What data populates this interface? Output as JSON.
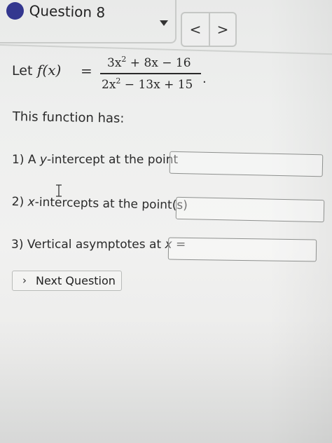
{
  "header": {
    "question_title": "Question 8",
    "prev_label": "<",
    "next_label": ">"
  },
  "problem": {
    "let_label": "Let",
    "function_lhs": "f(x)",
    "equals": "=",
    "numerator": {
      "a": "3x",
      "exp": "2",
      "rest": " + 8x − 16"
    },
    "denominator": {
      "a": "2x",
      "exp": "2",
      "rest": " − 13x + 15"
    },
    "period": "."
  },
  "intro_text": "This function has:",
  "items": [
    {
      "prefix": "1) A ",
      "var": "y",
      "suffix": "-intercept at the point"
    },
    {
      "prefix": "2) ",
      "var": "x",
      "suffix": "-intercepts at the point(s)"
    },
    {
      "prefix": "3) Vertical asymptotes at ",
      "var": "x",
      "suffix": " ="
    }
  ],
  "answers": [
    "",
    "",
    ""
  ],
  "next_question_label": "Next Question",
  "colors": {
    "question_dot": "#34378f",
    "background": "#eeefee",
    "border": "#8e908e"
  },
  "icons": {
    "status": "filled-circle",
    "dropdown": "caret-down-icon",
    "prev": "chevron-left-icon",
    "next": "chevron-right-icon",
    "next_question": "chevron-right-icon",
    "cursor": "text-cursor-icon"
  }
}
